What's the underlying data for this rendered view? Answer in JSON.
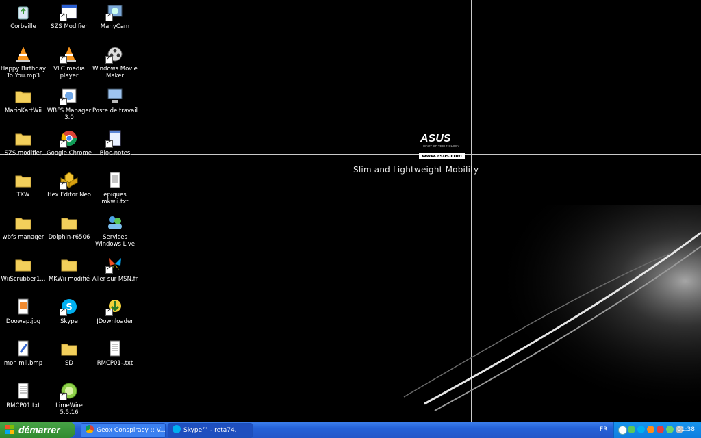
{
  "desktop": {
    "wallpaper": {
      "logo": "ASUS",
      "logo_sub": "HEART OF TECHNOLOGY",
      "url": "www.asus.com",
      "tagline": "Slim and Lightweight Mobility"
    },
    "icons": [
      {
        "label": "Corbeille",
        "icon": "recycle-bin-icon",
        "shortcut": false
      },
      {
        "label": "SZS Modifier",
        "icon": "app-window-icon",
        "shortcut": true
      },
      {
        "label": "ManyCam",
        "icon": "manycam-icon",
        "shortcut": true
      },
      {
        "label": "Happy Birthday To You.mp3",
        "icon": "vlc-cone-icon",
        "shortcut": false
      },
      {
        "label": "VLC media player",
        "icon": "vlc-cone-icon",
        "shortcut": true
      },
      {
        "label": "Windows Movie Maker",
        "icon": "film-reel-icon",
        "shortcut": true
      },
      {
        "label": "MarioKartWii",
        "icon": "folder-icon",
        "shortcut": false
      },
      {
        "label": "WBFS Manager 3.0",
        "icon": "wbfs-icon",
        "shortcut": true
      },
      {
        "label": "Poste de travail",
        "icon": "computer-icon",
        "shortcut": false
      },
      {
        "label": "SZS modifier",
        "icon": "folder-icon",
        "shortcut": false
      },
      {
        "label": "Google Chrome",
        "icon": "chrome-icon",
        "shortcut": true
      },
      {
        "label": "Bloc-notes",
        "icon": "notepad-icon",
        "shortcut": true
      },
      {
        "label": "TKW",
        "icon": "folder-icon",
        "shortcut": false
      },
      {
        "label": "Hex Editor Neo",
        "icon": "hex-editor-icon",
        "shortcut": true
      },
      {
        "label": "epiques mkwii.txt",
        "icon": "text-file-icon",
        "shortcut": false
      },
      {
        "label": "wbfs manager",
        "icon": "folder-icon",
        "shortcut": false
      },
      {
        "label": "Dolphin-r6506",
        "icon": "folder-icon",
        "shortcut": false
      },
      {
        "label": "Services Windows Live",
        "icon": "windows-live-icon",
        "shortcut": false
      },
      {
        "label": "WiiScrubber1...",
        "icon": "folder-icon",
        "shortcut": false
      },
      {
        "label": "MKWii modifié",
        "icon": "folder-icon",
        "shortcut": false
      },
      {
        "label": "Aller sur MSN.fr",
        "icon": "msn-butterfly-icon",
        "shortcut": true
      },
      {
        "label": "Doowap.jpg",
        "icon": "image-file-icon",
        "shortcut": false
      },
      {
        "label": "Skype",
        "icon": "skype-icon",
        "shortcut": true
      },
      {
        "label": "JDownloader",
        "icon": "jdownloader-icon",
        "shortcut": true
      },
      {
        "label": "mon mii.bmp",
        "icon": "paint-file-icon",
        "shortcut": false
      },
      {
        "label": "SD",
        "icon": "folder-icon",
        "shortcut": false
      },
      {
        "label": "RMCP01-.txt",
        "icon": "text-file-icon",
        "shortcut": false
      },
      {
        "label": "RMCP01.txt",
        "icon": "text-file-icon",
        "shortcut": false
      },
      {
        "label": "LimeWire 5.5.16",
        "icon": "limewire-icon",
        "shortcut": true
      }
    ]
  },
  "taskbar": {
    "start_label": "démarrer",
    "tasks": [
      {
        "label": "Geox Conspiracy :: V...",
        "icon": "chrome-icon",
        "active": false
      },
      {
        "label": "Skype™ - reta74.",
        "icon": "skype-icon",
        "active": true
      }
    ],
    "language": "FR",
    "clock": "01:38"
  },
  "colors": {
    "taskbar": "#2562d8",
    "start": "#3c9a3b",
    "tray": "#1794ed"
  }
}
